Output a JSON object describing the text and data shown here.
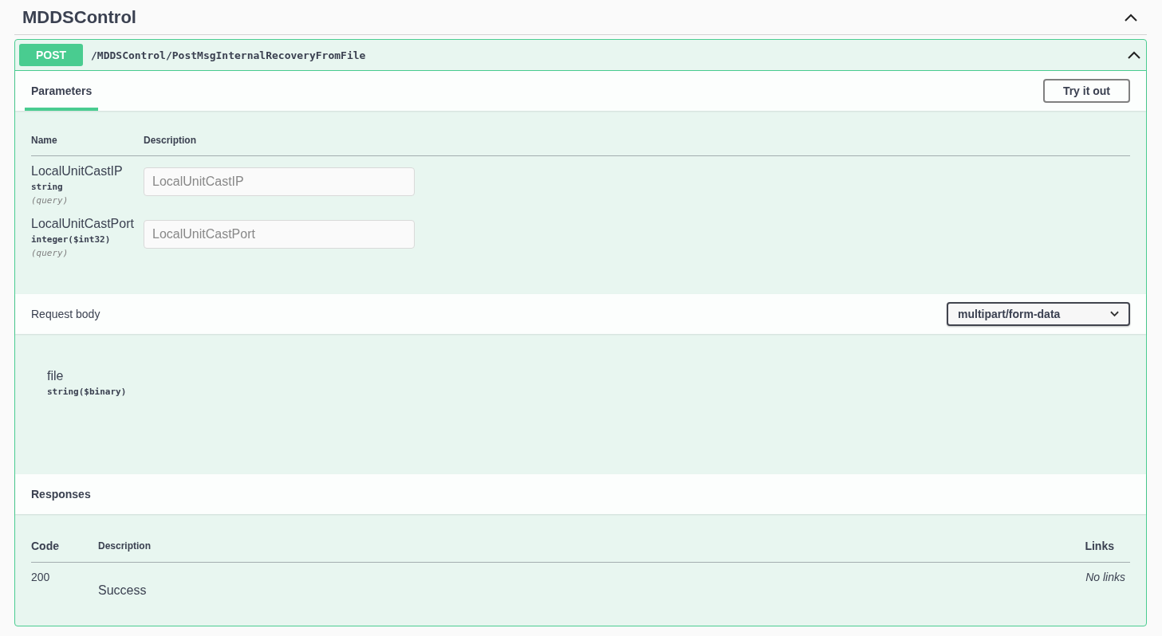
{
  "tag": {
    "title": "MDDSControl",
    "expanded": true
  },
  "operation": {
    "method": "POST",
    "path": "/MDDSControl/PostMsgInternalRecoveryFromFile",
    "expanded": true
  },
  "tabs": [
    {
      "label": "Parameters",
      "selected": true
    }
  ],
  "try_button": "Try it out",
  "parameters": {
    "columns": [
      "Name",
      "Description"
    ],
    "rows": [
      {
        "name": "LocalUnitCastIP",
        "type": "string",
        "location": "(query)",
        "placeholder": "LocalUnitCastIP"
      },
      {
        "name": "LocalUnitCastPort",
        "type": "integer($int32)",
        "location": "(query)",
        "placeholder": "LocalUnitCastPort"
      }
    ]
  },
  "request_body": {
    "label": "Request body",
    "content_type": "multipart/form-data",
    "fields": [
      {
        "name": "file",
        "type": "string($binary)"
      }
    ]
  },
  "responses": {
    "title": "Responses",
    "columns": [
      "Code",
      "Description",
      "Links"
    ],
    "rows": [
      {
        "code": "200",
        "description": "Success",
        "links": "No links"
      }
    ]
  }
}
